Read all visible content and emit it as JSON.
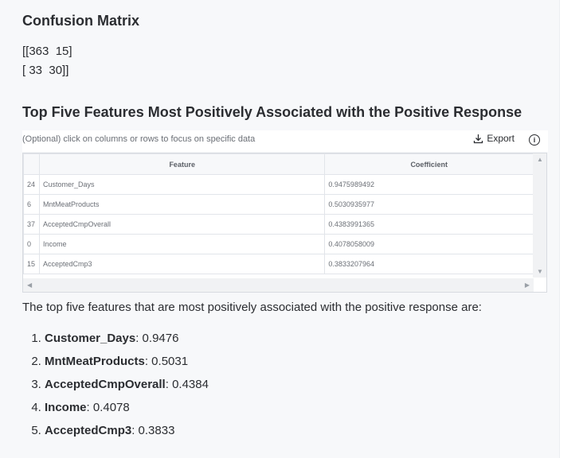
{
  "confusion": {
    "title": "Confusion Matrix",
    "row1": "[[363  15]",
    "row2": "[ 33  30]]"
  },
  "features": {
    "title": "Top Five Features Most Positively Associated with the Positive Response",
    "hint": "(Optional) click on columns or rows to focus on specific data",
    "export_label": "Export",
    "columns": [
      "Feature",
      "Coefficient"
    ],
    "rows": [
      {
        "index": "24",
        "feature": "Customer_Days",
        "coefficient": "0.9475989492"
      },
      {
        "index": "6",
        "feature": "MntMeatProducts",
        "coefficient": "0.5030935977"
      },
      {
        "index": "37",
        "feature": "AcceptedCmpOverall",
        "coefficient": "0.4383991365"
      },
      {
        "index": "0",
        "feature": "Income",
        "coefficient": "0.4078058009"
      },
      {
        "index": "15",
        "feature": "AcceptedCmp3",
        "coefficient": "0.3833207964"
      }
    ]
  },
  "summary": {
    "text": "The top five features that are most positively associated with the positive response are:",
    "items": [
      {
        "name": "Customer_Days",
        "value": ": 0.9476"
      },
      {
        "name": "MntMeatProducts",
        "value": ": 0.5031"
      },
      {
        "name": "AcceptedCmpOverall",
        "value": ": 0.4384"
      },
      {
        "name": "Income",
        "value": ": 0.4078"
      },
      {
        "name": "AcceptedCmp3",
        "value": ": 0.3833"
      }
    ]
  }
}
